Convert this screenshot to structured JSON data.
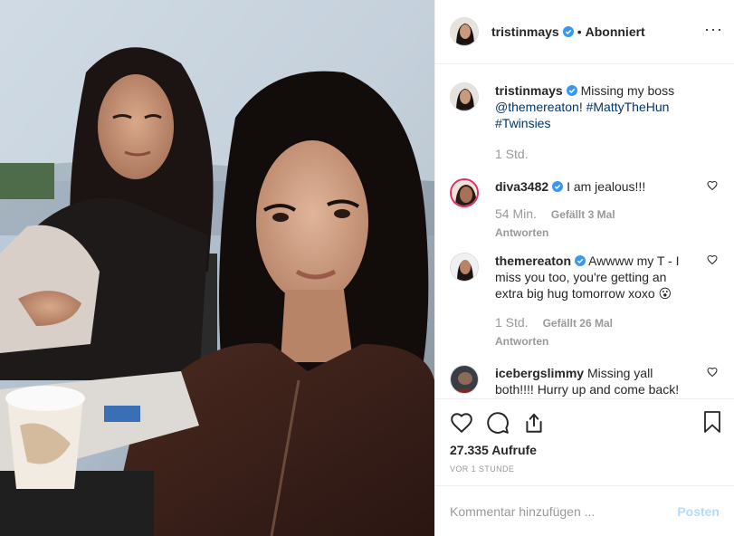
{
  "header": {
    "username": "tristinmays",
    "separator": "•",
    "follow_status": "Abonniert",
    "more_icon": "ellipsis-icon"
  },
  "caption": {
    "username": "tristinmays",
    "text_plain": "Missing my boss",
    "mention": "@themereaton",
    "after_mention": "!",
    "hashtag1": "#MattyTheHun",
    "hashtag2": "#Twinsies",
    "time": "1 Std."
  },
  "comments": [
    {
      "username": "diva3482",
      "text": "I am jealous!!!",
      "time": "54 Min.",
      "likes": "Gefällt 3 Mal",
      "reply": "Antworten"
    },
    {
      "username": "themereaton",
      "text": "Awwww my T - I miss you too, you're getting an extra big hug tomorrow xoxo 😮",
      "time": "1 Std.",
      "likes": "Gefällt 26 Mal",
      "reply": "Antworten"
    },
    {
      "username": "icebergslimmy",
      "text": "Missing yall both!!!! Hurry up and come back!"
    }
  ],
  "actions": {
    "like_icon": "heart-icon",
    "comment_icon": "comment-icon",
    "share_icon": "share-icon",
    "save_icon": "bookmark-icon",
    "likes_count": "27.335 Aufrufe",
    "posted_ago": "VOR 1 STUNDE"
  },
  "add_comment": {
    "placeholder": "Kommentar hinzufügen ...",
    "post_label": "Posten"
  },
  "colors": {
    "verified_blue": "#3897f0",
    "link": "#003569",
    "muted": "#999999",
    "post_disabled": "#b3dbff"
  }
}
